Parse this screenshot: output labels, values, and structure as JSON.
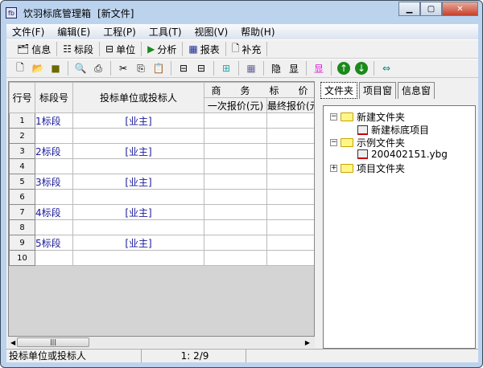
{
  "window": {
    "title": "饮羽标底管理箱",
    "doc": "[新文件]",
    "icon_text": "fb"
  },
  "menu": [
    "文件(F)",
    "编辑(E)",
    "工程(P)",
    "工具(T)",
    "视图(V)",
    "帮助(H)"
  ],
  "toolbar1": [
    "信息",
    "标段",
    "单位",
    "分析",
    "报表",
    "补充"
  ],
  "toolbar2": {
    "hide": "隐",
    "show": "显",
    "show2": "显"
  },
  "grid": {
    "headers": {
      "row": "行号",
      "segment": "标段号",
      "bidder": "投标单位或投标人",
      "group": "商　　务　　标　　价",
      "first": "一次报价(元)",
      "final": "最终报价(元)"
    },
    "rows": [
      {
        "n": "1",
        "seg": "1标段",
        "unit": "[业主]"
      },
      {
        "n": "2",
        "seg": "",
        "unit": ""
      },
      {
        "n": "3",
        "seg": "2标段",
        "unit": "[业主]"
      },
      {
        "n": "4",
        "seg": "",
        "unit": ""
      },
      {
        "n": "5",
        "seg": "3标段",
        "unit": "[业主]"
      },
      {
        "n": "6",
        "seg": "",
        "unit": ""
      },
      {
        "n": "7",
        "seg": "4标段",
        "unit": "[业主]"
      },
      {
        "n": "8",
        "seg": "",
        "unit": ""
      },
      {
        "n": "9",
        "seg": "5标段",
        "unit": "[业主]"
      },
      {
        "n": "10",
        "seg": "",
        "unit": ""
      }
    ]
  },
  "tabs": [
    "文件夹",
    "项目窗",
    "信息窗"
  ],
  "tree": {
    "f1": "新建文件夹",
    "f1c": "新建标底项目",
    "f2": "示例文件夹",
    "f2c": "200402151.ybg",
    "f3": "项目文件夹"
  },
  "status": {
    "field": "投标单位或投标人",
    "pos": "1: 2/9"
  }
}
